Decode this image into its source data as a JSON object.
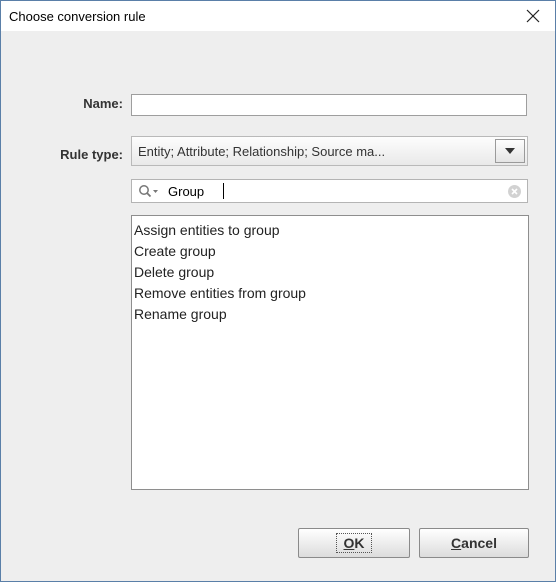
{
  "dialog": {
    "title": "Choose conversion rule"
  },
  "form": {
    "name_label": "Name:",
    "name_value": "",
    "rule_type_label": "Rule type:",
    "rule_type_value": "Entity; Attribute; Relationship; Source ma..."
  },
  "search": {
    "value": "Group"
  },
  "rules": [
    "Assign entities to group",
    "Create group",
    "Delete group",
    "Remove entities from group",
    "Rename group"
  ],
  "buttons": {
    "ok_mnemonic": "O",
    "ok_rest": "K",
    "cancel_mnemonic": "C",
    "cancel_rest": "ancel"
  },
  "icons": {
    "close": "close-icon",
    "dropdown": "chevron-down-icon",
    "search": "search-icon",
    "clear": "clear-icon"
  }
}
